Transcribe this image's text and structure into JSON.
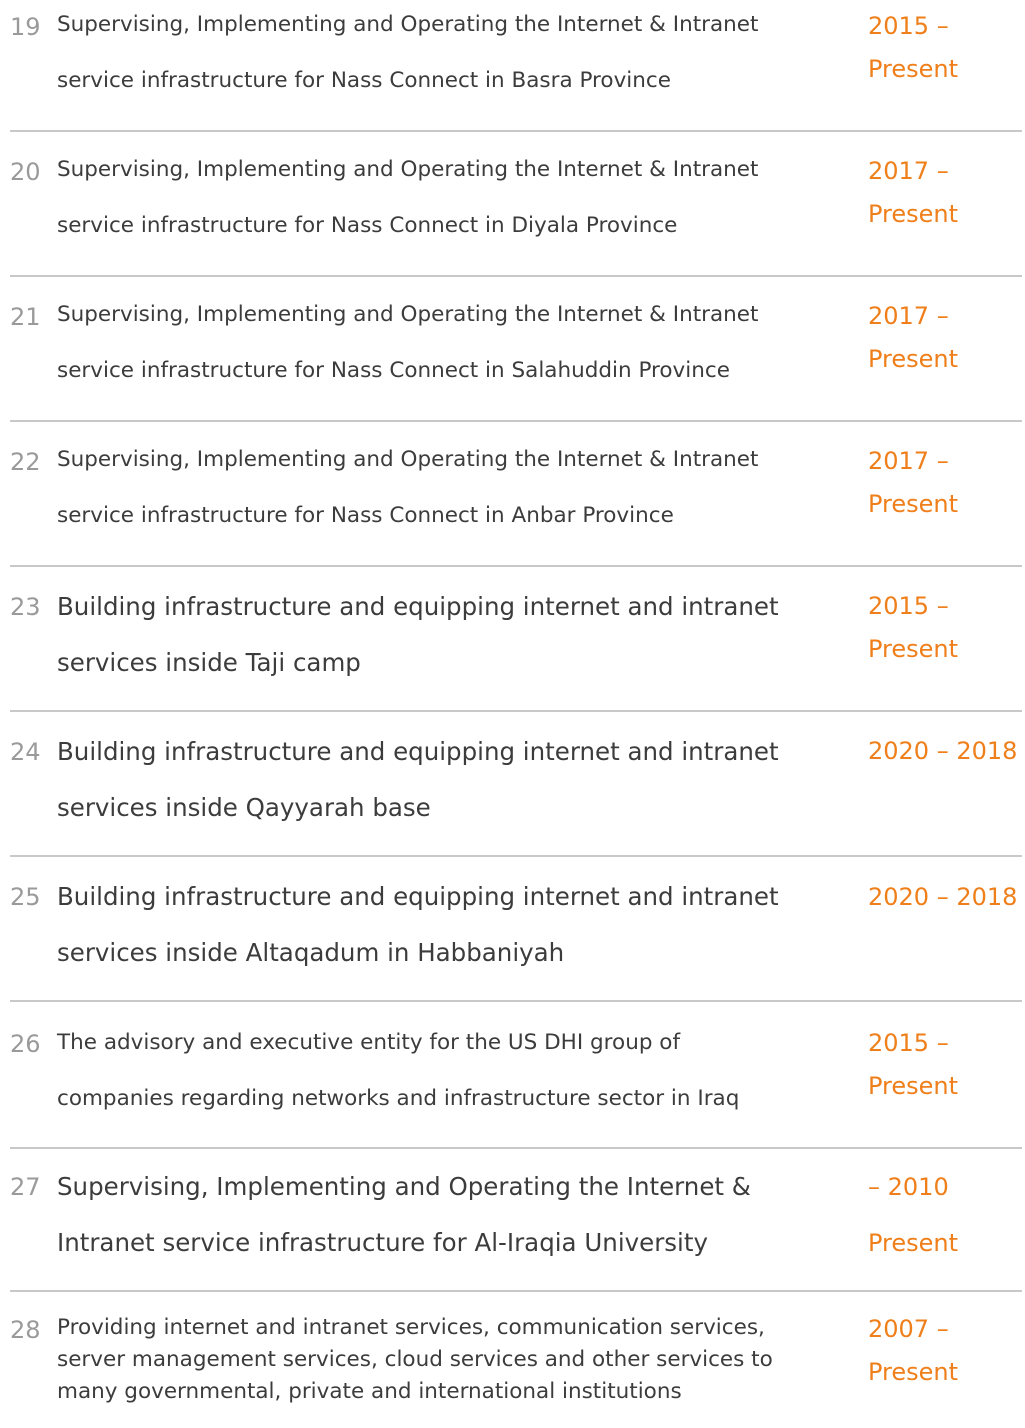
{
  "rows": [
    {
      "number": "19",
      "lines": [
        "Supervising, Implementing and Operating the Internet & Intranet",
        "service infrastructure for Nass Connect in Basra Province"
      ],
      "date_lines": [
        "2015 –",
        "Present"
      ]
    },
    {
      "number": "20",
      "lines": [
        "Supervising, Implementing and Operating the Internet & Intranet",
        "service infrastructure for Nass Connect in Diyala Province"
      ],
      "date_lines": [
        "2017 –",
        "Present"
      ]
    },
    {
      "number": "21",
      "lines": [
        "Supervising, Implementing and Operating the Internet & Intranet",
        "service infrastructure for Nass Connect in Salahuddin Province"
      ],
      "date_lines": [
        "2017 –",
        "Present"
      ]
    },
    {
      "number": "22",
      "lines": [
        "Supervising, Implementing and Operating the Internet & Intranet",
        "service infrastructure for Nass Connect in Anbar Province"
      ],
      "date_lines": [
        "2017 –",
        "Present"
      ]
    },
    {
      "number": "23",
      "lines": [
        "Building infrastructure and equipping internet and intranet",
        "services inside Taji camp"
      ],
      "date_lines": [
        "2015 –",
        "Present"
      ]
    },
    {
      "number": "24",
      "lines": [
        "Building infrastructure and equipping internet and intranet",
        "services inside Qayyarah base"
      ],
      "date_lines": [
        "2020 – 2018"
      ]
    },
    {
      "number": "25",
      "lines": [
        "Building infrastructure and equipping internet and intranet",
        "services inside Altaqadum in Habbaniyah"
      ],
      "date_lines": [
        "2020 – 2018"
      ]
    },
    {
      "number": "26",
      "lines": [
        "The advisory and executive entity for the US DHI group of",
        "companies regarding networks and infrastructure sector in Iraq"
      ],
      "date_lines": [
        "2015 –",
        "Present"
      ]
    },
    {
      "number": "27",
      "lines": [
        "Supervising, Implementing and Operating the Internet &",
        "Intranet service infrastructure for Al-Iraqia University"
      ],
      "date_lines": [
        "– 2010",
        "Present"
      ]
    },
    {
      "number": "28",
      "lines": [
        "Providing internet and intranet services, communication services,",
        "server management services, cloud services and other services to",
        "many governmental, private and international institutions"
      ],
      "date_lines": [
        "2007 –",
        "Present"
      ]
    }
  ],
  "colors": {
    "number": "#9a9a9a",
    "text": "#3c3c3c",
    "date": "#ef7f1a",
    "divider": "#c8c8c8"
  }
}
